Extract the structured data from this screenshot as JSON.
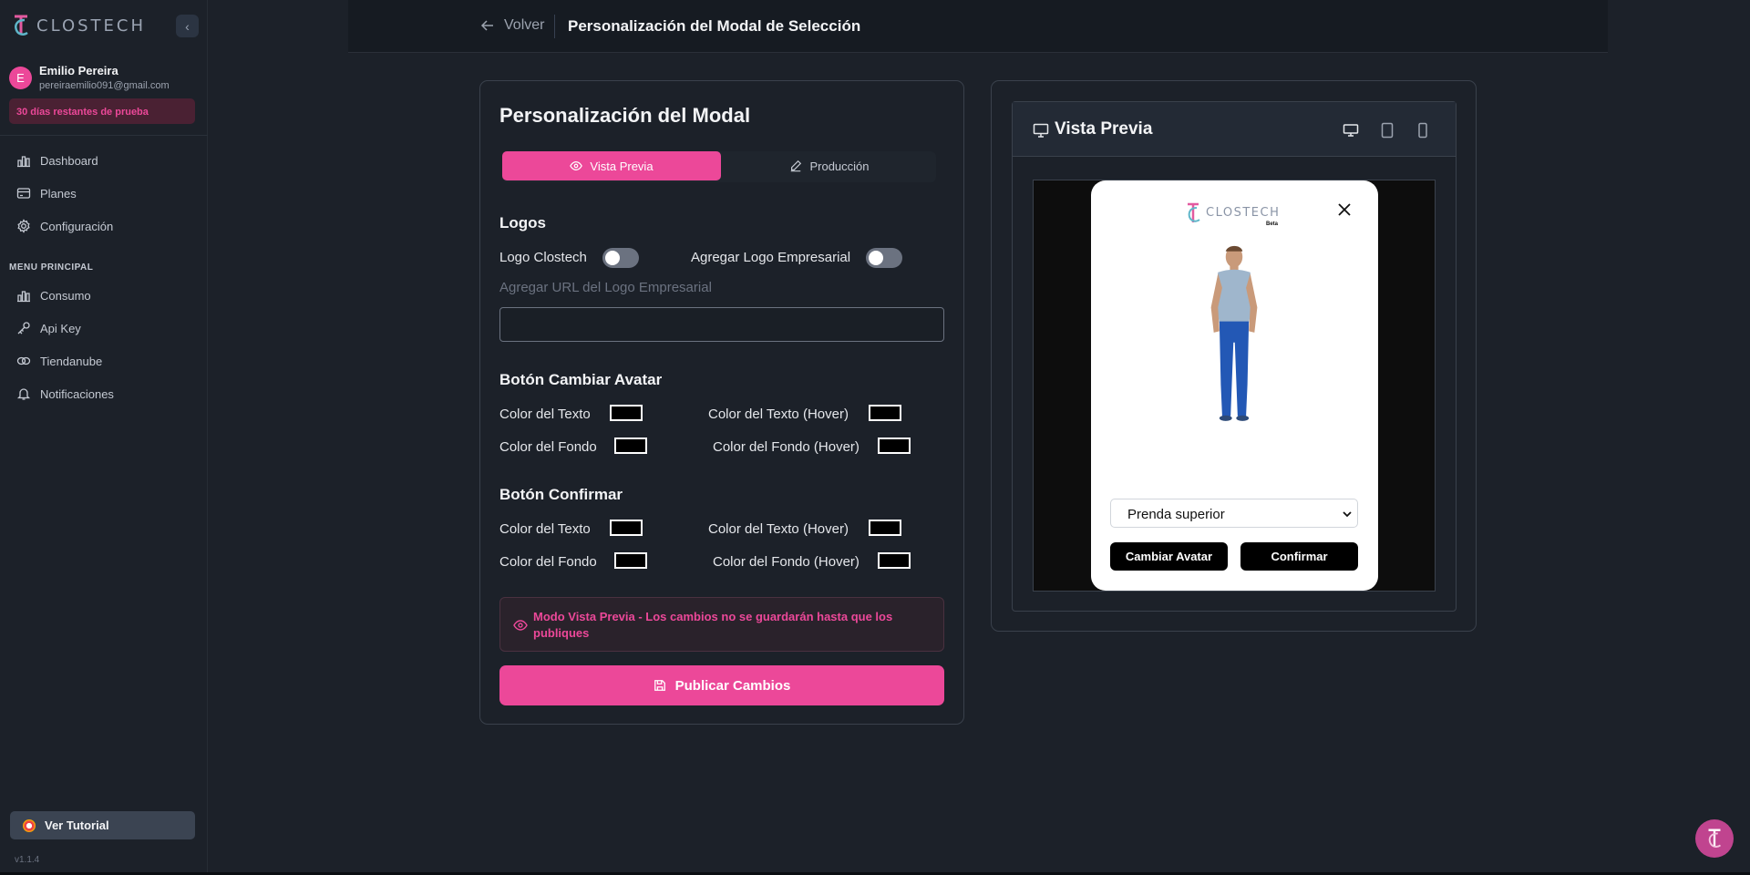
{
  "brand": {
    "name": "CLOSTECH"
  },
  "user": {
    "initial": "E",
    "name": "Emilio Pereira",
    "email": "pereiraemilio091@gmail.com",
    "trial": "30 días restantes de prueba"
  },
  "sidebar": {
    "items": [
      {
        "label": "Dashboard",
        "icon": "bar-chart-icon"
      },
      {
        "label": "Planes",
        "icon": "credit-card-icon"
      },
      {
        "label": "Configuración",
        "icon": "gear-icon"
      }
    ],
    "section_label": "MENU PRINCIPAL",
    "main_items": [
      {
        "label": "Consumo",
        "icon": "bar-chart-icon"
      },
      {
        "label": "Api Key",
        "icon": "key-icon"
      },
      {
        "label": "Tiendanube",
        "icon": "cloud-icon"
      },
      {
        "label": "Notificaciones",
        "icon": "bell-icon"
      }
    ],
    "tutorial": "Ver Tutorial",
    "version": "v1.1.4"
  },
  "header": {
    "back": "Volver",
    "title": "Personalización del Modal de Selección"
  },
  "editor": {
    "title": "Personalización del Modal",
    "tabs": {
      "preview": "Vista Previa",
      "production": "Producción"
    },
    "logos": {
      "heading": "Logos",
      "clostech_label": "Logo Clostech",
      "business_label": "Agregar Logo Empresarial",
      "url_label": "Agregar URL del Logo Empresarial",
      "url_value": ""
    },
    "change_avatar": {
      "heading": "Botón Cambiar Avatar",
      "text_color": "Color del Texto",
      "text_hover": "Color del Texto (Hover)",
      "bg_color": "Color del Fondo",
      "bg_hover": "Color del Fondo (Hover)"
    },
    "confirm": {
      "heading": "Botón Confirmar",
      "text_color": "Color del Texto",
      "text_hover": "Color del Texto (Hover)",
      "bg_color": "Color del Fondo",
      "bg_hover": "Color del Fondo (Hover)"
    },
    "notice": "Modo Vista Previa - Los cambios no se guardarán hasta que los publiques",
    "publish": "Publicar Cambios"
  },
  "preview": {
    "title": "Vista Previa",
    "modal": {
      "logo_text": "CLOSTECH",
      "logo_sub": "Beta",
      "select_value": "Prenda superior",
      "change_avatar": "Cambiar Avatar",
      "confirm": "Confirmar"
    }
  },
  "colors": {
    "accent": "#ec4899",
    "background": "#1c2129",
    "topbar": "#161b22"
  }
}
